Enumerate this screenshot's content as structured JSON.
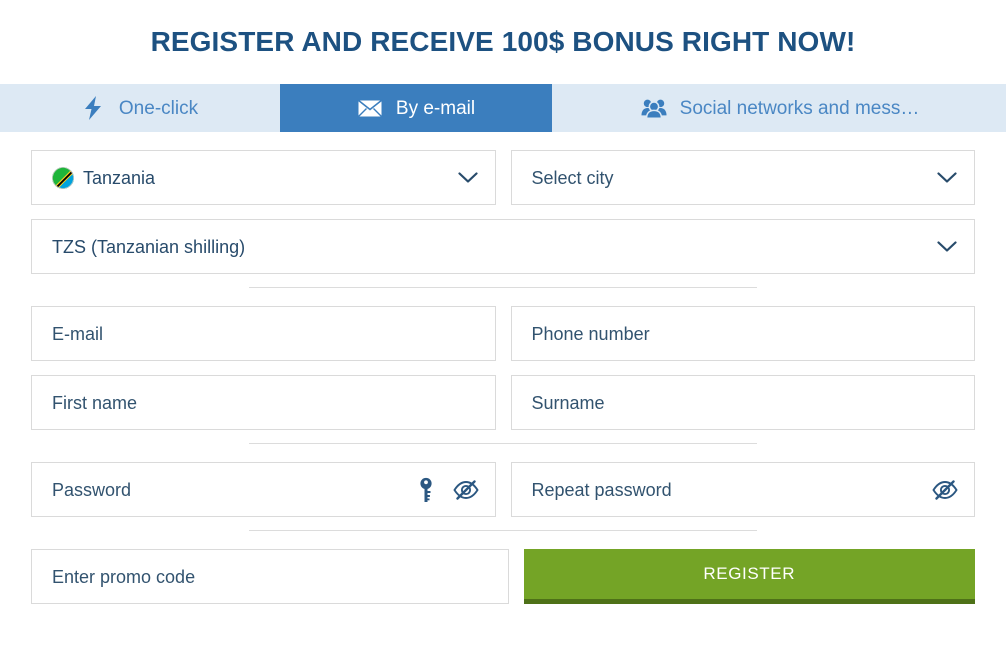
{
  "header": {
    "title": "REGISTER AND RECEIVE 100$ BONUS RIGHT NOW!",
    "title_color": "#1d5181"
  },
  "tabs": {
    "active_index": 1,
    "active_bg": "#3b7ebe",
    "bar_bg": "#dde9f4",
    "items": [
      {
        "label": "One-click",
        "icon": "lightning-bolt-icon"
      },
      {
        "label": "By e-mail",
        "icon": "envelope-icon"
      },
      {
        "label": "Social networks and mess…",
        "icon": "people-group-icon"
      }
    ]
  },
  "form": {
    "country": {
      "label": "country-select",
      "value": "Tanzania",
      "flag": "tanzania-flag-icon",
      "chevron": "chevron-down-icon"
    },
    "city": {
      "value": "Select city",
      "chevron": "chevron-down-icon"
    },
    "currency": {
      "value": "TZS (Tanzanian shilling)",
      "chevron": "chevron-down-icon"
    },
    "email": {
      "placeholder": "E-mail",
      "value": ""
    },
    "phone": {
      "placeholder": "Phone number",
      "value": ""
    },
    "first_name": {
      "placeholder": "First name",
      "value": ""
    },
    "surname": {
      "placeholder": "Surname",
      "value": ""
    },
    "password": {
      "placeholder": "Password",
      "value": "",
      "key_icon": "key-icon",
      "toggle_icon": "eye-slash-icon"
    },
    "repeat_password": {
      "placeholder": "Repeat password",
      "value": "",
      "toggle_icon": "eye-slash-icon"
    },
    "promo": {
      "placeholder": "Enter promo code",
      "value": ""
    },
    "submit": {
      "label": "REGISTER",
      "bg": "#74a426",
      "shadow": "#4e7118"
    }
  }
}
